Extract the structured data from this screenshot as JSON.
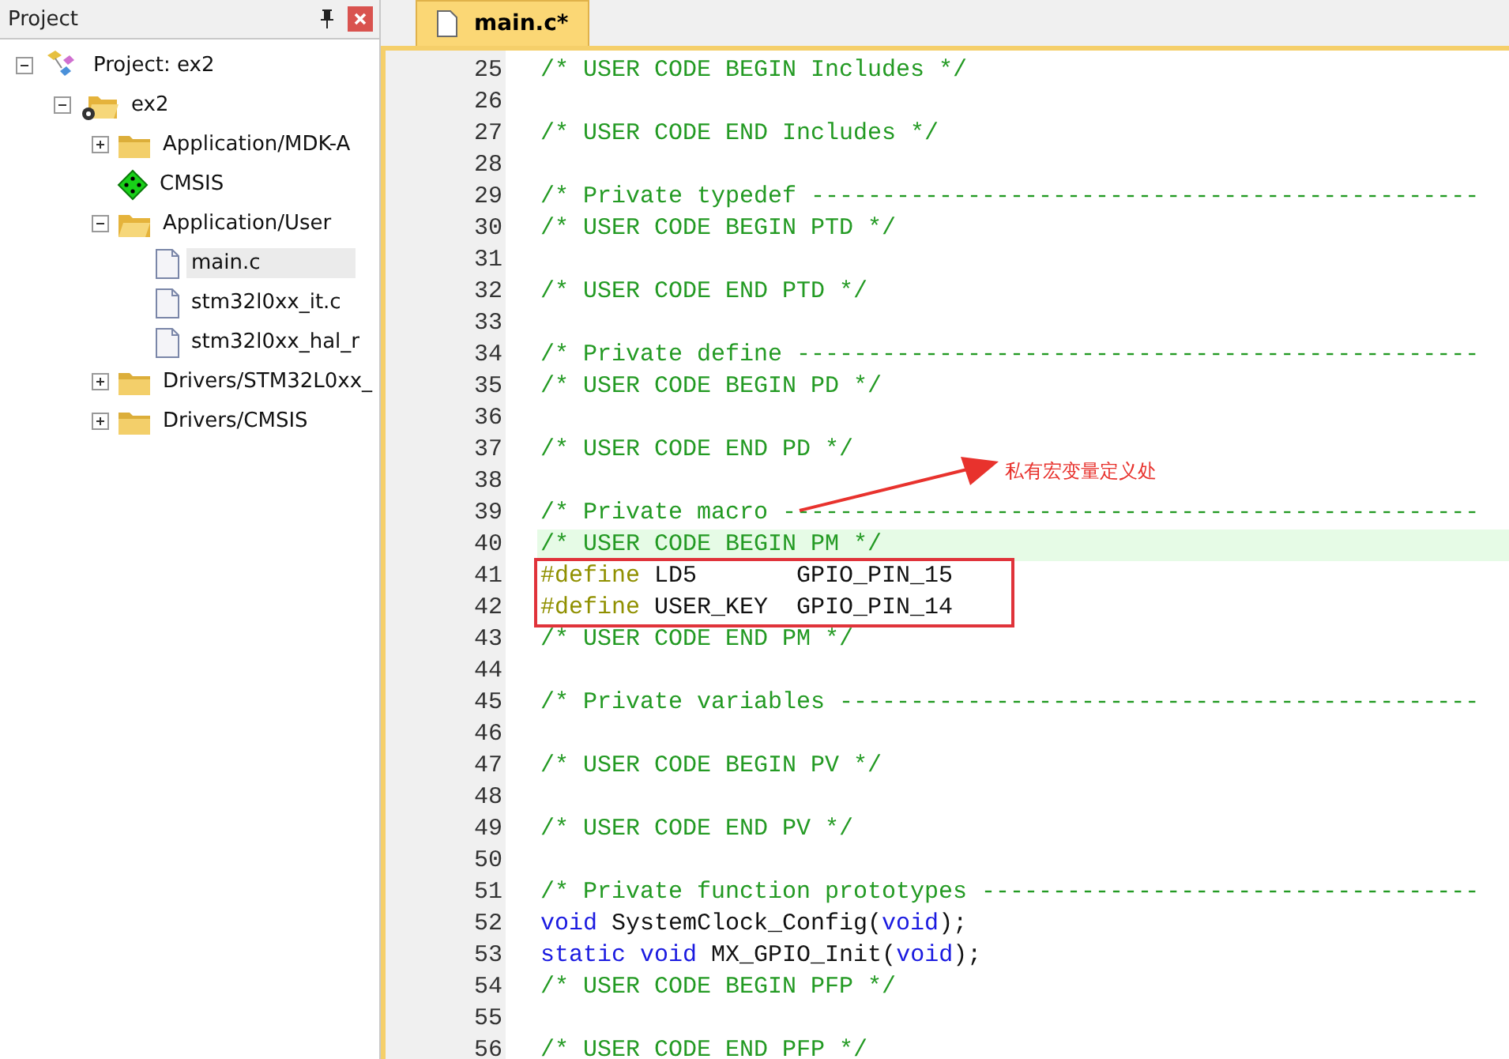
{
  "project_panel": {
    "title": "Project",
    "tree": [
      {
        "label": "Project: ex2",
        "kind": "project",
        "expanded": true,
        "children": [
          {
            "label": "ex2",
            "kind": "target",
            "expanded": true,
            "children": [
              {
                "label": "Application/MDK-A",
                "kind": "folder",
                "expanded": false
              },
              {
                "label": "CMSIS",
                "kind": "component"
              },
              {
                "label": "Application/User",
                "kind": "folder",
                "expanded": true,
                "children": [
                  {
                    "label": "main.c",
                    "kind": "file",
                    "selected": true
                  },
                  {
                    "label": "stm32l0xx_it.c",
                    "kind": "file",
                    "selected": false
                  },
                  {
                    "label": "stm32l0xx_hal_r",
                    "kind": "file",
                    "selected": false
                  }
                ]
              },
              {
                "label": "Drivers/STM32L0xx_",
                "kind": "folder",
                "expanded": false
              },
              {
                "label": "Drivers/CMSIS",
                "kind": "folder",
                "expanded": false
              }
            ]
          }
        ]
      }
    ]
  },
  "editor": {
    "tabs": [
      {
        "label": "main.c*",
        "selected": true
      }
    ],
    "lines": [
      {
        "number": "25",
        "tokens": [
          {
            "kind": "comment",
            "text": "/* USER CODE BEGIN Includes */"
          }
        ]
      },
      {
        "number": "26"
      },
      {
        "number": "27",
        "tokens": [
          {
            "kind": "comment",
            "text": "/* USER CODE END Includes */"
          }
        ]
      },
      {
        "number": "28"
      },
      {
        "number": "29",
        "tokens": [
          {
            "kind": "comment",
            "text": "/* Private typedef -----------------------------------------------"
          }
        ]
      },
      {
        "number": "30",
        "tokens": [
          {
            "kind": "comment",
            "text": "/* USER CODE BEGIN PTD */"
          }
        ]
      },
      {
        "number": "31"
      },
      {
        "number": "32",
        "tokens": [
          {
            "kind": "comment",
            "text": "/* USER CODE END PTD */"
          }
        ]
      },
      {
        "number": "33"
      },
      {
        "number": "34",
        "tokens": [
          {
            "kind": "comment",
            "text": "/* Private define ------------------------------------------------"
          }
        ]
      },
      {
        "number": "35",
        "tokens": [
          {
            "kind": "comment",
            "text": "/* USER CODE BEGIN PD */"
          }
        ]
      },
      {
        "number": "36"
      },
      {
        "number": "37",
        "tokens": [
          {
            "kind": "comment",
            "text": "/* USER CODE END PD */"
          }
        ]
      },
      {
        "number": "38"
      },
      {
        "number": "39",
        "tokens": [
          {
            "kind": "comment",
            "text": "/* Private macro -------------------------------------------------"
          }
        ]
      },
      {
        "number": "40",
        "current": true,
        "tokens": [
          {
            "kind": "comment",
            "text": "/* USER CODE BEGIN PM */"
          }
        ]
      },
      {
        "number": "41",
        "boxed": true,
        "tokens": [
          {
            "kind": "directive",
            "text": "#define"
          },
          {
            "kind": "plain",
            "text": " LD5       GPIO_PIN_15"
          }
        ]
      },
      {
        "number": "42",
        "boxed": true,
        "tokens": [
          {
            "kind": "directive",
            "text": "#define"
          },
          {
            "kind": "plain",
            "text": " USER_KEY  GPIO_PIN_14"
          }
        ]
      },
      {
        "number": "43",
        "tokens": [
          {
            "kind": "comment",
            "text": "/* USER CODE END PM */"
          }
        ]
      },
      {
        "number": "44"
      },
      {
        "number": "45",
        "tokens": [
          {
            "kind": "comment",
            "text": "/* Private variables ---------------------------------------------"
          }
        ]
      },
      {
        "number": "46"
      },
      {
        "number": "47",
        "tokens": [
          {
            "kind": "comment",
            "text": "/* USER CODE BEGIN PV */"
          }
        ]
      },
      {
        "number": "48"
      },
      {
        "number": "49",
        "tokens": [
          {
            "kind": "comment",
            "text": "/* USER CODE END PV */"
          }
        ]
      },
      {
        "number": "50"
      },
      {
        "number": "51",
        "tokens": [
          {
            "kind": "comment",
            "text": "/* Private function prototypes -----------------------------------"
          }
        ]
      },
      {
        "number": "52",
        "tokens": [
          {
            "kind": "keyword",
            "text": "void"
          },
          {
            "kind": "plain",
            "text": " SystemClock_Config("
          },
          {
            "kind": "keyword",
            "text": "void"
          },
          {
            "kind": "plain",
            "text": ");"
          }
        ]
      },
      {
        "number": "53",
        "tokens": [
          {
            "kind": "keyword",
            "text": "static void"
          },
          {
            "kind": "plain",
            "text": " MX_GPIO_Init("
          },
          {
            "kind": "keyword",
            "text": "void"
          },
          {
            "kind": "plain",
            "text": ");"
          }
        ]
      },
      {
        "number": "54",
        "tokens": [
          {
            "kind": "comment",
            "text": "/* USER CODE BEGIN PFP */"
          }
        ]
      },
      {
        "number": "55"
      },
      {
        "number": "56",
        "tokens": [
          {
            "kind": "comment",
            "text": "/* USER CODE END PFP */"
          }
        ]
      }
    ],
    "annotation": {
      "text": "私有宏变量定义处"
    }
  }
}
